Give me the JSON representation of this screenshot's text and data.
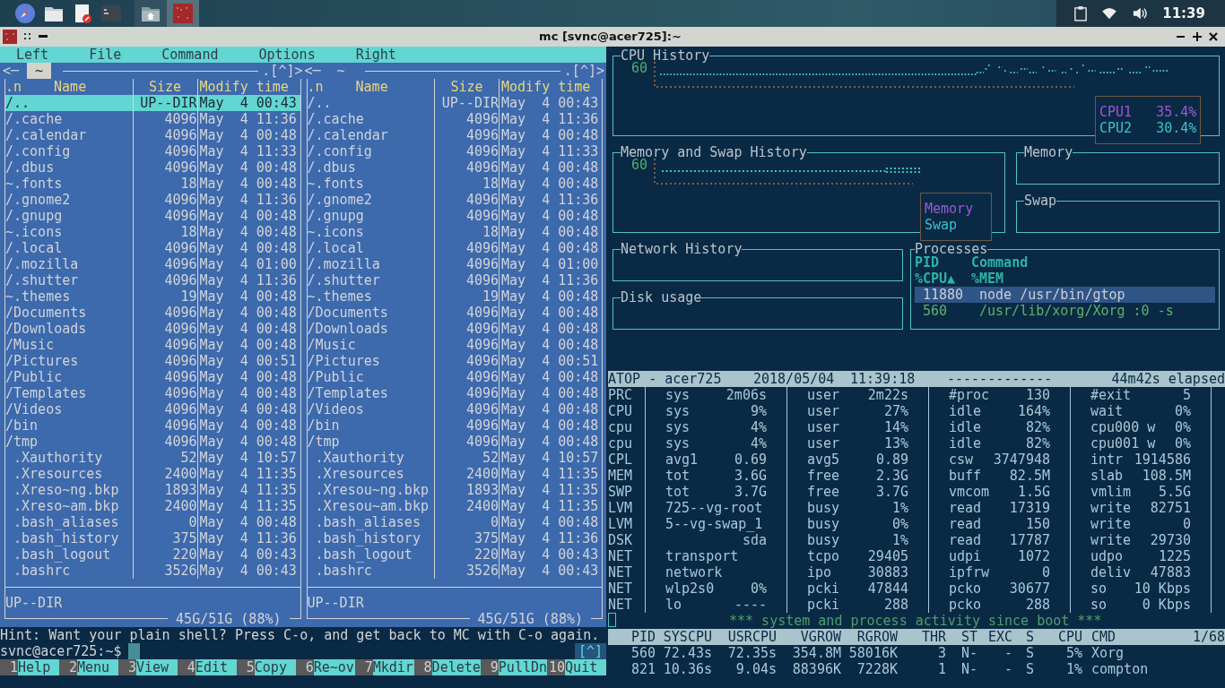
{
  "taskbar": {
    "clock": "11:39"
  },
  "window": {
    "title": "mc [svnc@acer725]:~"
  },
  "mc": {
    "menu": [
      {
        "label": "Left"
      },
      {
        "label": "File"
      },
      {
        "label": "Command"
      },
      {
        "label": "Options"
      },
      {
        "label": "Right"
      }
    ],
    "panels": [
      {
        "active": true,
        "nav_left": "<─",
        "path": "~",
        "nav_right": ".[^]>",
        "columns": {
          "sort": ".n",
          "name": "Name",
          "size": "Size",
          "time": "Modify time"
        },
        "status": "UP--DIR",
        "disk": "45G/51G (88%)",
        "rows": [
          {
            "kind": "dir",
            "name": "/..",
            "size": "UP--DIR",
            "time": "May  4 00:43",
            "selected": true
          },
          {
            "kind": "dir",
            "name": "/.cache",
            "size": "4096",
            "time": "May  4 11:36",
            "selected": false
          },
          {
            "kind": "dir",
            "name": "/.calendar",
            "size": "4096",
            "time": "May  4 00:48",
            "selected": false
          },
          {
            "kind": "dir",
            "name": "/.config",
            "size": "4096",
            "time": "May  4 11:33",
            "selected": false
          },
          {
            "kind": "dir",
            "name": "/.dbus",
            "size": "4096",
            "time": "May  4 00:48",
            "selected": false
          },
          {
            "kind": "link",
            "name": "~.fonts",
            "size": "18",
            "time": "May  4 00:48",
            "selected": false
          },
          {
            "kind": "dir",
            "name": "/.gnome2",
            "size": "4096",
            "time": "May  4 11:36",
            "selected": false
          },
          {
            "kind": "dir",
            "name": "/.gnupg",
            "size": "4096",
            "time": "May  4 00:48",
            "selected": false
          },
          {
            "kind": "link",
            "name": "~.icons",
            "size": "18",
            "time": "May  4 00:48",
            "selected": false
          },
          {
            "kind": "dir",
            "name": "/.local",
            "size": "4096",
            "time": "May  4 00:48",
            "selected": false
          },
          {
            "kind": "dir",
            "name": "/.mozilla",
            "size": "4096",
            "time": "May  4 01:00",
            "selected": false
          },
          {
            "kind": "dir",
            "name": "/.shutter",
            "size": "4096",
            "time": "May  4 11:36",
            "selected": false
          },
          {
            "kind": "link",
            "name": "~.themes",
            "size": "19",
            "time": "May  4 00:48",
            "selected": false
          },
          {
            "kind": "dir",
            "name": "/Documents",
            "size": "4096",
            "time": "May  4 00:48",
            "selected": false
          },
          {
            "kind": "dir",
            "name": "/Downloads",
            "size": "4096",
            "time": "May  4 00:48",
            "selected": false
          },
          {
            "kind": "dir",
            "name": "/Music",
            "size": "4096",
            "time": "May  4 00:48",
            "selected": false
          },
          {
            "kind": "dir",
            "name": "/Pictures",
            "size": "4096",
            "time": "May  4 00:51",
            "selected": false
          },
          {
            "kind": "dir",
            "name": "/Public",
            "size": "4096",
            "time": "May  4 00:48",
            "selected": false
          },
          {
            "kind": "dir",
            "name": "/Templates",
            "size": "4096",
            "time": "May  4 00:48",
            "selected": false
          },
          {
            "kind": "dir",
            "name": "/Videos",
            "size": "4096",
            "time": "May  4 00:48",
            "selected": false
          },
          {
            "kind": "dir",
            "name": "/bin",
            "size": "4096",
            "time": "May  4 00:48",
            "selected": false
          },
          {
            "kind": "dir",
            "name": "/tmp",
            "size": "4096",
            "time": "May  4 00:48",
            "selected": false
          },
          {
            "kind": "file",
            "name": ".Xauthority",
            "size": "52",
            "time": "May  4 10:57",
            "selected": false
          },
          {
            "kind": "file",
            "name": ".Xresources",
            "size": "2400",
            "time": "May  4 11:35",
            "selected": false
          },
          {
            "kind": "file",
            "name": ".Xreso~ng.bkp",
            "size": "1893",
            "time": "May  4 11:35",
            "selected": false
          },
          {
            "kind": "file",
            "name": ".Xreso~am.bkp",
            "size": "2400",
            "time": "May  4 11:35",
            "selected": false
          },
          {
            "kind": "file",
            "name": ".bash_aliases",
            "size": "0",
            "time": "May  4 00:48",
            "selected": false
          },
          {
            "kind": "file",
            "name": ".bash_history",
            "size": "375",
            "time": "May  4 11:36",
            "selected": false
          },
          {
            "kind": "file",
            "name": ".bash_logout",
            "size": "220",
            "time": "May  4 00:43",
            "selected": false
          },
          {
            "kind": "file",
            "name": ".bashrc",
            "size": "3526",
            "time": "May  4 00:43",
            "selected": false
          }
        ]
      },
      {
        "active": false,
        "nav_left": "<─",
        "path": "~",
        "nav_right": ".[^]>",
        "columns": {
          "sort": ".n",
          "name": "Name",
          "size": "Size",
          "time": "Modify time"
        },
        "status": "UP--DIR",
        "disk": "45G/51G (88%)",
        "rows": [
          {
            "kind": "dir",
            "name": "/..",
            "size": "UP--DIR",
            "time": "May  4 00:43",
            "selected": false
          },
          {
            "kind": "dir",
            "name": "/.cache",
            "size": "4096",
            "time": "May  4 11:36",
            "selected": false
          },
          {
            "kind": "dir",
            "name": "/.calendar",
            "size": "4096",
            "time": "May  4 00:48",
            "selected": false
          },
          {
            "kind": "dir",
            "name": "/.config",
            "size": "4096",
            "time": "May  4 11:33",
            "selected": false
          },
          {
            "kind": "dir",
            "name": "/.dbus",
            "size": "4096",
            "time": "May  4 00:48",
            "selected": false
          },
          {
            "kind": "link",
            "name": "~.fonts",
            "size": "18",
            "time": "May  4 00:48",
            "selected": false
          },
          {
            "kind": "dir",
            "name": "/.gnome2",
            "size": "4096",
            "time": "May  4 11:36",
            "selected": false
          },
          {
            "kind": "dir",
            "name": "/.gnupg",
            "size": "4096",
            "time": "May  4 00:48",
            "selected": false
          },
          {
            "kind": "link",
            "name": "~.icons",
            "size": "18",
            "time": "May  4 00:48",
            "selected": false
          },
          {
            "kind": "dir",
            "name": "/.local",
            "size": "4096",
            "time": "May  4 00:48",
            "selected": false
          },
          {
            "kind": "dir",
            "name": "/.mozilla",
            "size": "4096",
            "time": "May  4 01:00",
            "selected": false
          },
          {
            "kind": "dir",
            "name": "/.shutter",
            "size": "4096",
            "time": "May  4 11:36",
            "selected": false
          },
          {
            "kind": "link",
            "name": "~.themes",
            "size": "19",
            "time": "May  4 00:48",
            "selected": false
          },
          {
            "kind": "dir",
            "name": "/Documents",
            "size": "4096",
            "time": "May  4 00:48",
            "selected": false
          },
          {
            "kind": "dir",
            "name": "/Downloads",
            "size": "4096",
            "time": "May  4 00:48",
            "selected": false
          },
          {
            "kind": "dir",
            "name": "/Music",
            "size": "4096",
            "time": "May  4 00:48",
            "selected": false
          },
          {
            "kind": "dir",
            "name": "/Pictures",
            "size": "4096",
            "time": "May  4 00:51",
            "selected": false
          },
          {
            "kind": "dir",
            "name": "/Public",
            "size": "4096",
            "time": "May  4 00:48",
            "selected": false
          },
          {
            "kind": "dir",
            "name": "/Templates",
            "size": "4096",
            "time": "May  4 00:48",
            "selected": false
          },
          {
            "kind": "dir",
            "name": "/Videos",
            "size": "4096",
            "time": "May  4 00:48",
            "selected": false
          },
          {
            "kind": "dir",
            "name": "/bin",
            "size": "4096",
            "time": "May  4 00:48",
            "selected": false
          },
          {
            "kind": "dir",
            "name": "/tmp",
            "size": "4096",
            "time": "May  4 00:48",
            "selected": false
          },
          {
            "kind": "file",
            "name": ".Xauthority",
            "size": "52",
            "time": "May  4 10:57",
            "selected": false
          },
          {
            "kind": "file",
            "name": ".Xresources",
            "size": "2400",
            "time": "May  4 11:35",
            "selected": false
          },
          {
            "kind": "file",
            "name": ".Xresou~ng.bkp",
            "size": "1893",
            "time": "May  4 11:35",
            "selected": false
          },
          {
            "kind": "file",
            "name": ".Xresou~am.bkp",
            "size": "2400",
            "time": "May  4 11:35",
            "selected": false
          },
          {
            "kind": "file",
            "name": ".bash_aliases",
            "size": "0",
            "time": "May  4 00:48",
            "selected": false
          },
          {
            "kind": "file",
            "name": ".bash_history",
            "size": "375",
            "time": "May  4 11:36",
            "selected": false
          },
          {
            "kind": "file",
            "name": ".bash_logout",
            "size": "220",
            "time": "May  4 00:43",
            "selected": false
          },
          {
            "kind": "file",
            "name": ".bashrc",
            "size": "3526",
            "time": "May  4 00:43",
            "selected": false
          }
        ]
      }
    ],
    "hint": "Hint: Want your plain shell? Press C-o, and get back to MC with C-o again.",
    "prompt": "svnc@acer725:~$",
    "scroll_marker": "[^]",
    "function_keys": [
      {
        "number": "1",
        "label": "Help"
      },
      {
        "number": "2",
        "label": "Menu"
      },
      {
        "number": "3",
        "label": "View"
      },
      {
        "number": "4",
        "label": "Edit"
      },
      {
        "number": "5",
        "label": "Copy"
      },
      {
        "number": "6",
        "label": "Re~ov"
      },
      {
        "number": "7",
        "label": "Mkdir"
      },
      {
        "number": "8",
        "label": "Delete"
      },
      {
        "number": "9",
        "label": "PullDn"
      },
      {
        "number": "10",
        "label": "Quit"
      }
    ]
  },
  "gtop": {
    "cpu_history": {
      "title": "CPU History",
      "y_label": "60",
      "legend": [
        {
          "label": "CPU1",
          "value": "35.4%",
          "color": "#9b59d6"
        },
        {
          "label": "CPU2",
          "value": "30.4%",
          "color": "#3fc1c9"
        }
      ]
    },
    "memory_history": {
      "title": "Memory and Swap History",
      "y_label": "60",
      "legend": [
        {
          "label": "Memory",
          "color": "#9b59d6"
        },
        {
          "label": "Swap",
          "color": "#3fc1c9"
        }
      ]
    },
    "memory": {
      "title": "Memory"
    },
    "swap": {
      "title": "Swap"
    },
    "network_history": {
      "title": "Network History"
    },
    "disk_usage": {
      "title": "Disk usage"
    },
    "processes": {
      "title": "Processes",
      "headers": [
        "PID",
        "Command",
        "%CPU▲",
        "%MEM"
      ],
      "rows": [
        {
          "pid": "11880",
          "command": "node /usr/bin/gtop",
          "selected": true
        },
        {
          "pid": "560",
          "command": "/usr/lib/xorg/Xorg :0 -s",
          "selected": false
        }
      ]
    }
  },
  "atop": {
    "title_bar": {
      "host": "ATOP - acer725",
      "date": "2018/05/04",
      "time": "11:39:18",
      "progress": "-------------",
      "elapsed": "44m42s elapsed"
    },
    "lines": [
      {
        "label": "PRC",
        "cells": [
          {
            "key": "sys",
            "value": "2m06s"
          },
          {
            "key": "user",
            "value": "2m22s"
          },
          {
            "key": "#proc",
            "value": "130"
          },
          {
            "key": "#exit",
            "value": "5"
          }
        ]
      },
      {
        "label": "CPU",
        "cells": [
          {
            "key": "sys",
            "value": "9%"
          },
          {
            "key": "user",
            "value": "27%"
          },
          {
            "key": "idle",
            "value": "164%"
          },
          {
            "key": "wait",
            "value": "0%"
          }
        ]
      },
      {
        "label": "cpu",
        "cells": [
          {
            "key": "sys",
            "value": "4%"
          },
          {
            "key": "user",
            "value": "14%"
          },
          {
            "key": "idle",
            "value": "82%"
          },
          {
            "key": "cpu000 w",
            "value": "0%"
          }
        ]
      },
      {
        "label": "cpu",
        "cells": [
          {
            "key": "sys",
            "value": "4%"
          },
          {
            "key": "user",
            "value": "13%"
          },
          {
            "key": "idle",
            "value": "82%"
          },
          {
            "key": "cpu001 w",
            "value": "0%"
          }
        ]
      },
      {
        "label": "CPL",
        "cells": [
          {
            "key": "avg1",
            "value": "0.69"
          },
          {
            "key": "avg5",
            "value": "0.89"
          },
          {
            "key": "csw",
            "value": "3747948"
          },
          {
            "key": "intr",
            "value": "1914586"
          }
        ]
      },
      {
        "label": "MEM",
        "cells": [
          {
            "key": "tot",
            "value": "3.6G"
          },
          {
            "key": "free",
            "value": "2.3G"
          },
          {
            "key": "buff",
            "value": "82.5M"
          },
          {
            "key": "slab",
            "value": "108.5M"
          }
        ]
      },
      {
        "label": "SWP",
        "cells": [
          {
            "key": "tot",
            "value": "3.7G"
          },
          {
            "key": "free",
            "value": "3.7G"
          },
          {
            "key": "vmcom",
            "value": "1.5G"
          },
          {
            "key": "vmlim",
            "value": "5.5G"
          }
        ]
      },
      {
        "label": "LVM",
        "cells": [
          {
            "key": "725--vg-root"
          },
          {
            "key": "busy",
            "value": "1%"
          },
          {
            "key": "read",
            "value": "17319"
          },
          {
            "key": "write",
            "value": "82751"
          }
        ]
      },
      {
        "label": "LVM",
        "cells": [
          {
            "key": "5--vg-swap_1"
          },
          {
            "key": "busy",
            "value": "0%"
          },
          {
            "key": "read",
            "value": "150"
          },
          {
            "key": "write",
            "value": "0"
          }
        ]
      },
      {
        "label": "DSK",
        "cells": [
          {
            "value": "sda"
          },
          {
            "key": "busy",
            "value": "1%"
          },
          {
            "key": "read",
            "value": "17787"
          },
          {
            "key": "write",
            "value": "29730"
          }
        ]
      },
      {
        "label": "NET",
        "cells": [
          {
            "key": "transport"
          },
          {
            "key": "tcpo",
            "value": "29405"
          },
          {
            "key": "udpi",
            "value": "1072"
          },
          {
            "key": "udpo",
            "value": "1225"
          }
        ]
      },
      {
        "label": "NET",
        "cells": [
          {
            "key": "network"
          },
          {
            "key": "ipo",
            "value": "30883"
          },
          {
            "key": "ipfrw",
            "value": "0"
          },
          {
            "key": "deliv",
            "value": "47883"
          }
        ]
      },
      {
        "label": "NET",
        "cells": [
          {
            "key": "wlp2s0",
            "value": "0%"
          },
          {
            "key": "pcki",
            "value": "47844"
          },
          {
            "key": "pcko",
            "value": "30677"
          },
          {
            "key": "so",
            "value": "10 Kbps"
          }
        ]
      },
      {
        "label": "NET",
        "cells": [
          {
            "key": "lo",
            "value": "----"
          },
          {
            "key": "pcki",
            "value": "288"
          },
          {
            "key": "pcko",
            "value": "288"
          },
          {
            "key": "so",
            "value": "0 Kbps"
          }
        ]
      }
    ],
    "message": "*** system and process activity since boot ***",
    "columns": [
      "PID",
      "SYSCPU",
      "USRCPU",
      "VGROW",
      "RGROW",
      "THR",
      "ST",
      "EXC",
      "S",
      "CPU",
      "CMD"
    ],
    "page": "1/68",
    "processes": [
      [
        "560",
        "72.43s",
        "72.35s",
        "354.8M",
        "58016K",
        "3",
        "N-",
        "-",
        "S",
        "5%",
        "Xorg"
      ],
      [
        "821",
        "10.36s",
        "9.04s",
        "88396K",
        "7228K",
        "1",
        "N-",
        "-",
        "S",
        "1%",
        "compton"
      ]
    ]
  }
}
